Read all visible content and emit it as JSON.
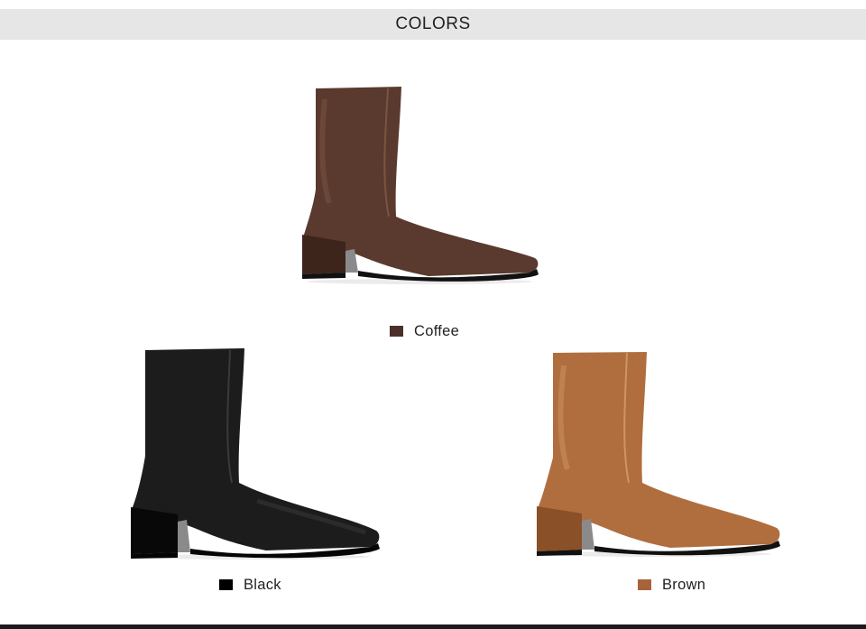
{
  "header": {
    "title": "COLORS"
  },
  "products": [
    {
      "name": "Coffee",
      "swatch_color": "#4a2f2a",
      "boot_color": "#5a3a2e",
      "boot_shade": "#3e251c",
      "boot_highlight": "#7a5444"
    },
    {
      "name": "Black",
      "swatch_color": "#000000",
      "boot_color": "#1c1c1c",
      "boot_shade": "#080808",
      "boot_highlight": "#3a3a3a"
    },
    {
      "name": "Brown",
      "swatch_color": "#a8633a",
      "boot_color": "#b06e3e",
      "boot_shade": "#8a5028",
      "boot_highlight": "#cf9466"
    }
  ]
}
